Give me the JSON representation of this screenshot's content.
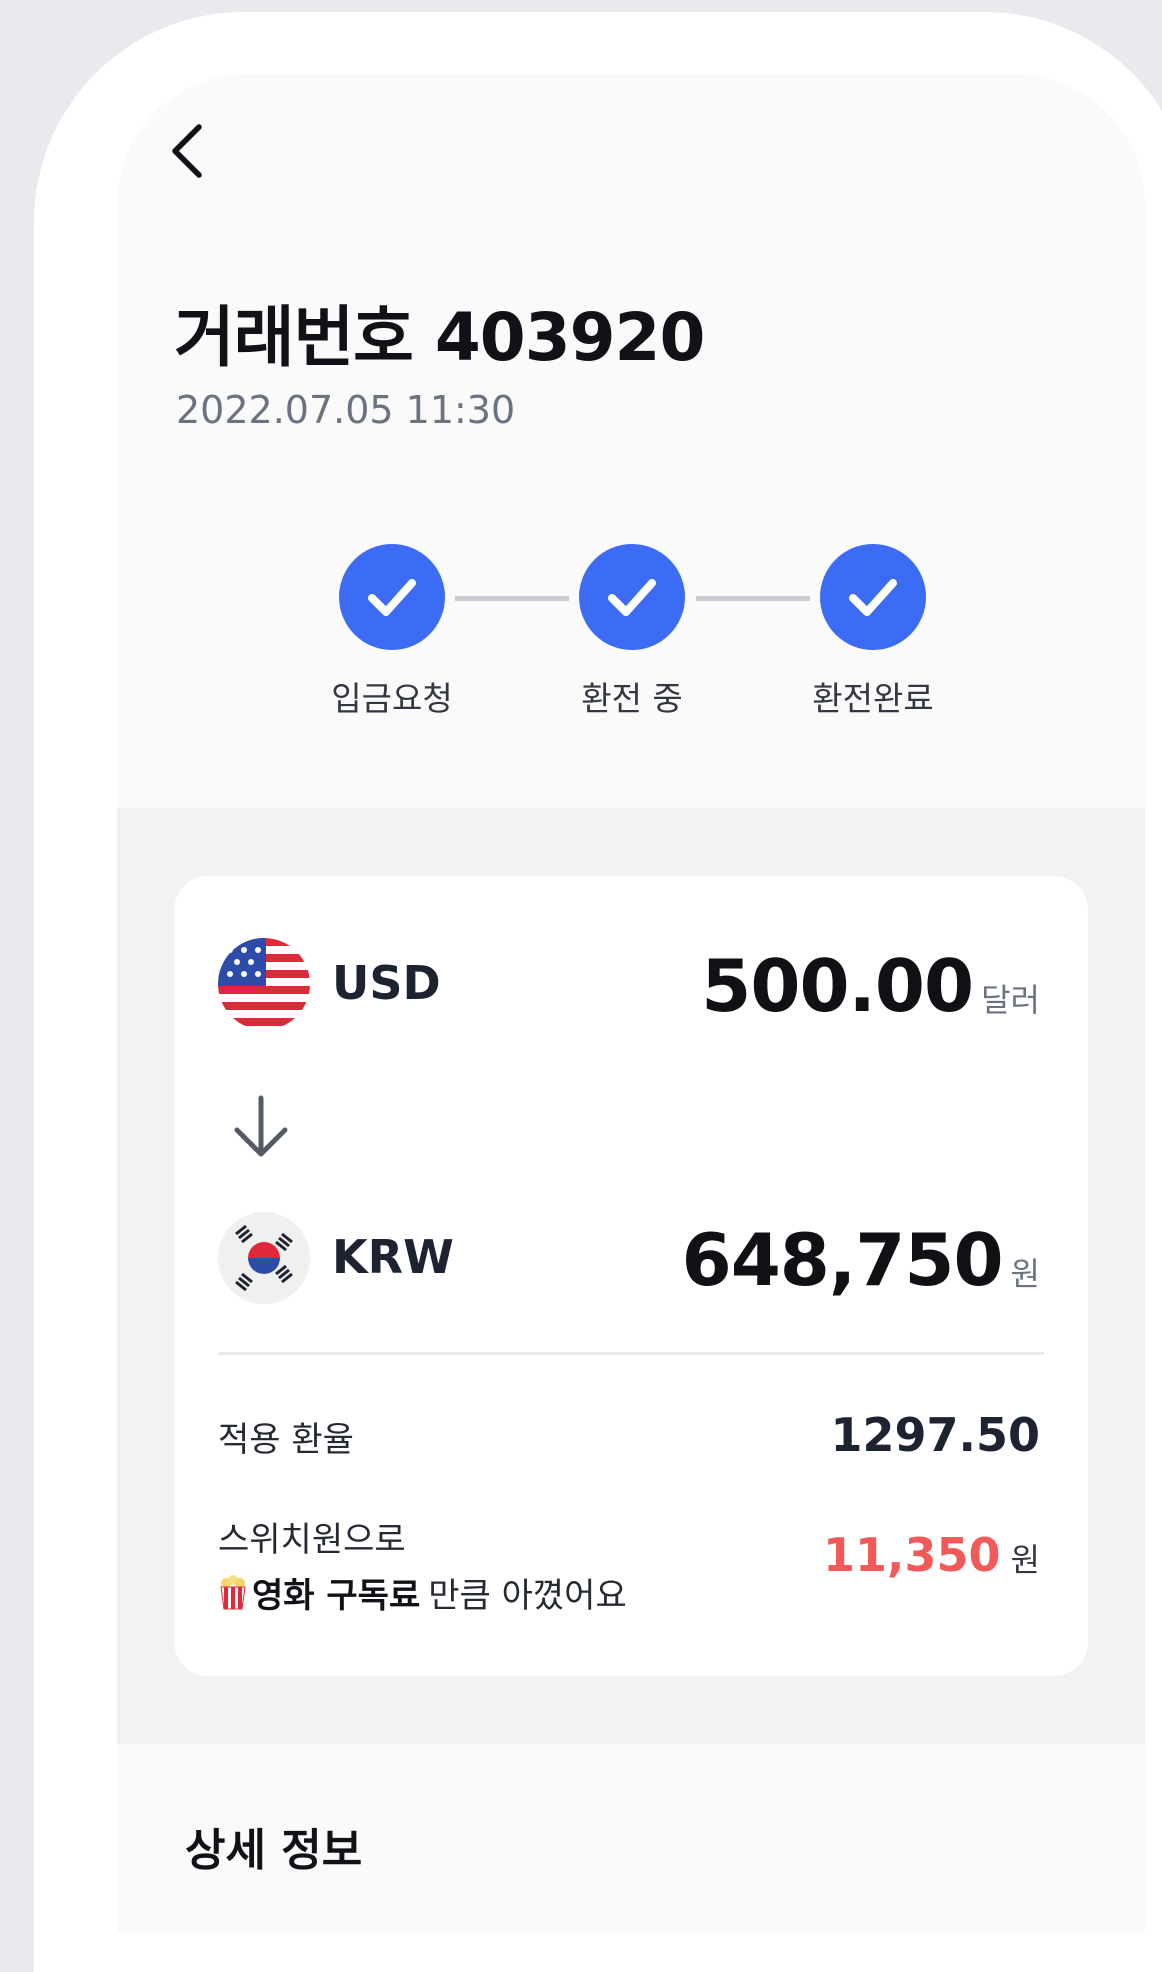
{
  "header": {
    "title": "거래번호 403920",
    "datetime": "2022.07.05 11:30"
  },
  "progress": {
    "steps": [
      {
        "label": "입금요청",
        "done": true
      },
      {
        "label": "환전 중",
        "done": true
      },
      {
        "label": "환전완료",
        "done": true
      }
    ]
  },
  "exchange": {
    "from": {
      "flag": "us-flag-icon",
      "code": "USD",
      "amount": "500.00",
      "unit": "달러"
    },
    "to": {
      "flag": "kr-flag-icon",
      "code": "KRW",
      "amount": "648,750",
      "unit": "원"
    },
    "rate": {
      "label": "적용 환율",
      "value": "1297.50"
    },
    "savings": {
      "line1": "스위치원으로",
      "emphasis": "영화 구독료",
      "rest": "만큼 아꼈어요",
      "amount": "11,350",
      "unit": "원"
    }
  },
  "details": {
    "title": "상세 정보"
  },
  "colors": {
    "accent": "#3c6cf6",
    "savings": "#f25a5a"
  }
}
